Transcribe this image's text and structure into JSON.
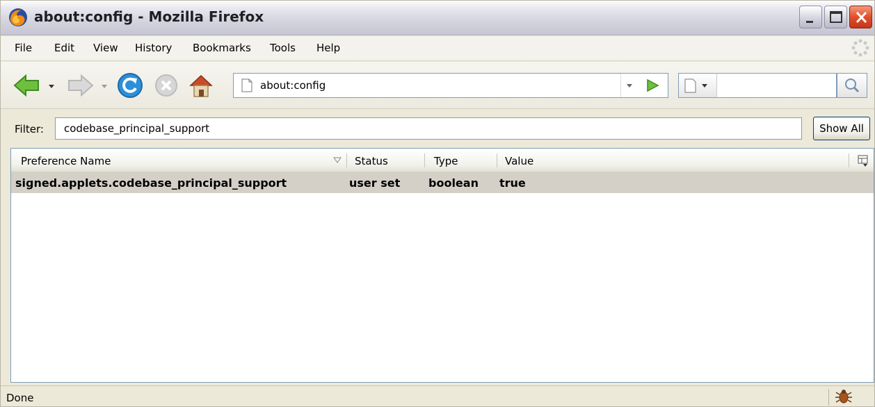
{
  "window": {
    "title": "about:config - Mozilla Firefox"
  },
  "menu": {
    "items": [
      {
        "label": "File"
      },
      {
        "label": "Edit"
      },
      {
        "label": "View"
      },
      {
        "label": "History"
      },
      {
        "label": "Bookmarks"
      },
      {
        "label": "Tools"
      },
      {
        "label": "Help"
      }
    ]
  },
  "toolbar": {
    "url": "about:config",
    "search_value": ""
  },
  "filter": {
    "label": "Filter:",
    "value": "codebase_principal_support",
    "show_all_label": "Show All"
  },
  "table": {
    "columns": [
      "Preference Name",
      "Status",
      "Type",
      "Value"
    ],
    "rows": [
      {
        "name": "signed.applets.codebase_principal_support",
        "status": "user set",
        "type": "boolean",
        "value": "true"
      }
    ]
  },
  "statusbar": {
    "text": "Done"
  },
  "icons": {
    "app": "firefox-icon",
    "back": "back-arrow-icon",
    "forward": "forward-arrow-icon",
    "reload": "reload-icon",
    "stop": "stop-icon",
    "home": "home-icon",
    "go": "go-arrow-icon",
    "search": "magnifier-icon",
    "status": "bug-icon"
  },
  "colors": {
    "selected_row": "#d4d0c8",
    "back_green": "#6fbf3f",
    "close_red": "#e0502a"
  }
}
